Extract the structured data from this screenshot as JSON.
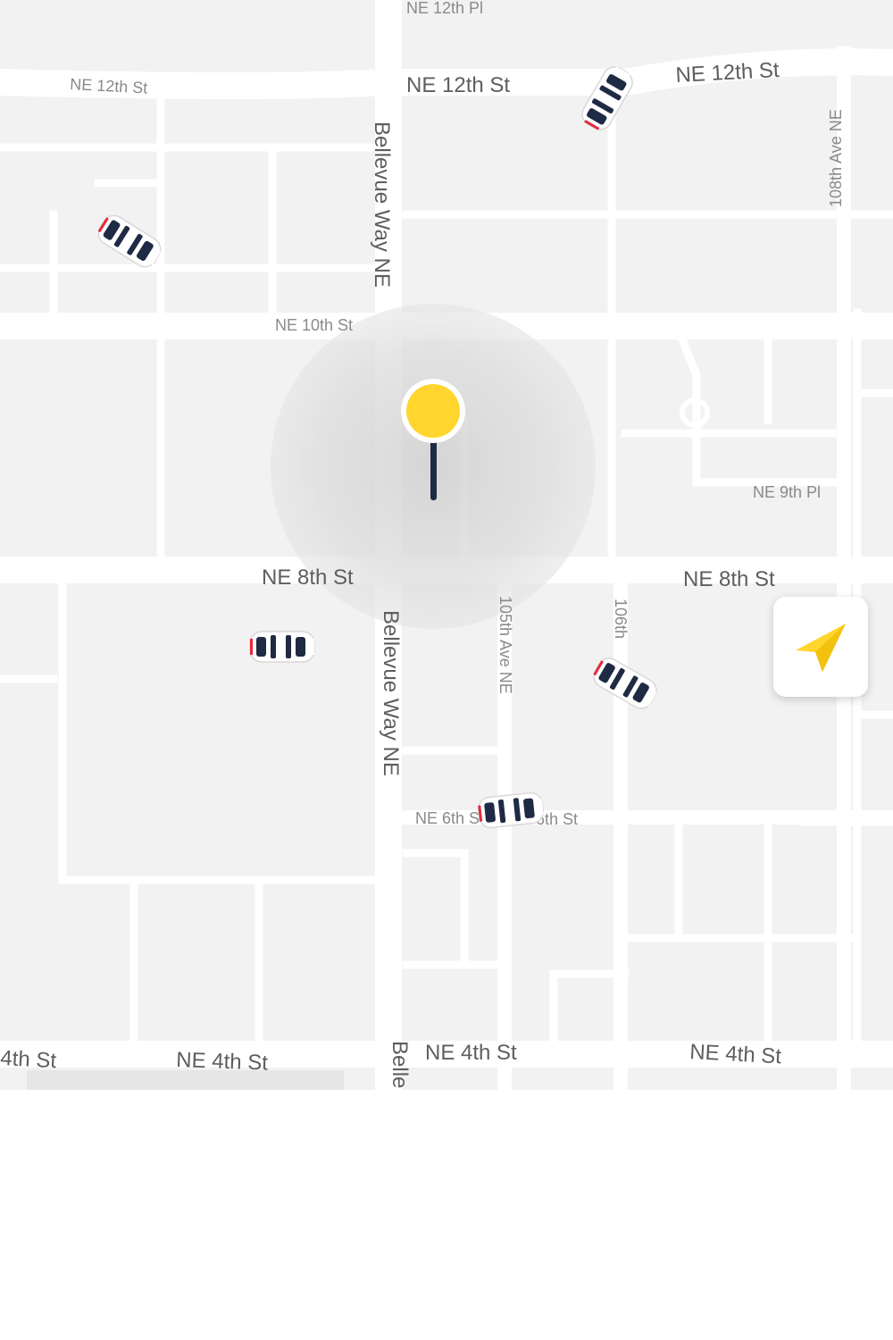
{
  "map": {
    "street_labels": [
      "NE 12th Pl",
      "NE 12th St",
      "NE 12th St",
      "NE 12th St",
      "Bellevue Way NE",
      "108th Ave NE",
      "NE 10th St",
      "NE 9th Pl",
      "NE 8th St",
      "NE 8th St",
      "Bellevue Way NE",
      "105th Ave NE",
      "106th",
      "NE 6th St",
      "6th St",
      "4th St",
      "NE 4th St",
      "NE 4th St",
      "NE 4th St",
      "Belle"
    ],
    "pin_color": "#FFD52E",
    "pin_stem_color": "#1f2a44",
    "car_body_color": "#ffffff",
    "car_window_color": "#1f2a44",
    "car_light_color": "#e8283a",
    "cars": [
      "car-icon",
      "car-icon",
      "car-icon",
      "car-icon",
      "car-icon"
    ]
  },
  "locate_button": {
    "icon": "navigation-arrow-icon",
    "color": "#FFD52E"
  }
}
